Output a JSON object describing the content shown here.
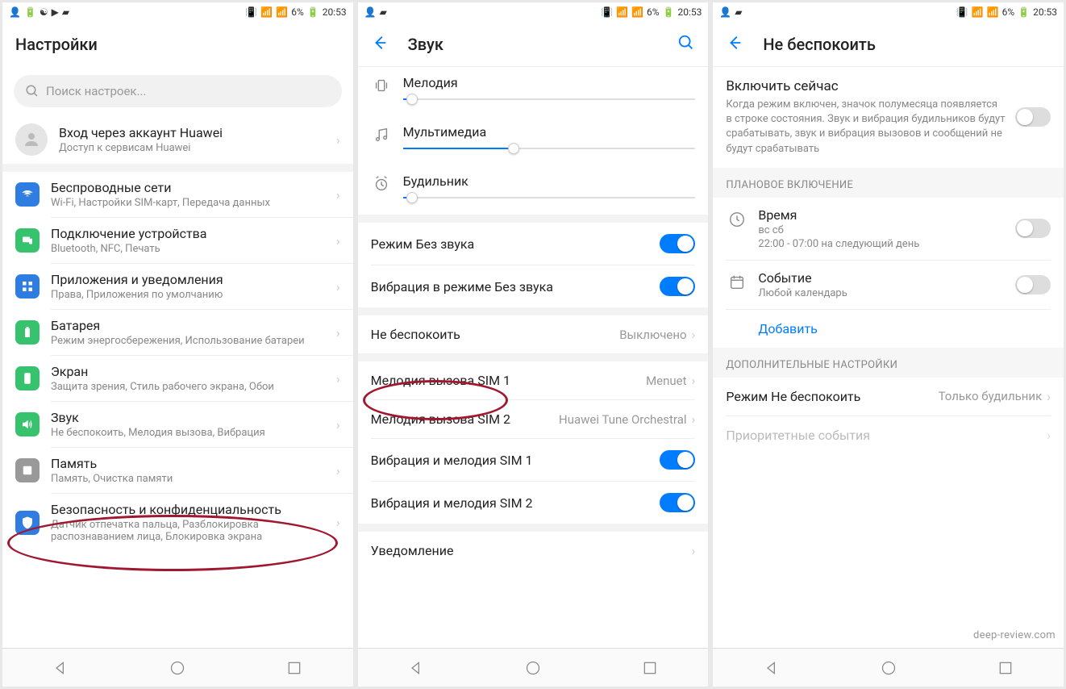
{
  "status": {
    "battery": "6%",
    "time": "20:53"
  },
  "screen1": {
    "title": "Настройки",
    "search_placeholder": "Поиск настроек...",
    "account": {
      "title": "Вход через аккаунт Huawei",
      "subtitle": "Доступ к сервисам Huawei"
    },
    "items": [
      {
        "title": "Беспроводные сети",
        "subtitle": "Wi-Fi, Настройки SIM-карт, Передача данных",
        "color": "#2f7de1"
      },
      {
        "title": "Подключение устройства",
        "subtitle": "Bluetooth, NFC, Печать",
        "color": "#37c26d"
      },
      {
        "title": "Приложения и уведомления",
        "subtitle": "Права, Приложения по умолчанию",
        "color": "#2f7de1"
      },
      {
        "title": "Батарея",
        "subtitle": "Режим энергосбережения, Использование батареи",
        "color": "#37c26d"
      },
      {
        "title": "Экран",
        "subtitle": "Защита зрения, Стиль рабочего экрана, Обои",
        "color": "#37c26d"
      },
      {
        "title": "Звук",
        "subtitle": "Не беспокоить, Мелодия вызова, Вибрация",
        "color": "#37c26d"
      },
      {
        "title": "Память",
        "subtitle": "Память, Очистка памяти",
        "color": "#999"
      },
      {
        "title": "Безопасность и конфиденциальность",
        "subtitle": "Датчик отпечатка пальца, Разблокировка распознаванием лица, Блокировка экрана",
        "color": "#2f7de1"
      }
    ]
  },
  "screen2": {
    "title": "Звук",
    "sliders": [
      {
        "label": "Мелодия",
        "value": 3
      },
      {
        "label": "Мультимедиа",
        "value": 38
      },
      {
        "label": "Будильник",
        "value": 3
      }
    ],
    "toggles": [
      {
        "label": "Режим Без звука",
        "on": true
      },
      {
        "label": "Вибрация в режиме Без звука",
        "on": true
      }
    ],
    "dnd": {
      "label": "Не беспокоить",
      "value": "Выключено"
    },
    "sim": [
      {
        "label": "Мелодия вызова SIM 1",
        "value": "Menuet"
      },
      {
        "label": "Мелодия вызова SIM 2",
        "value": "Huawei Tune Orchestral"
      }
    ],
    "vib": [
      {
        "label": "Вибрация и мелодия SIM 1",
        "on": true
      },
      {
        "label": "Вибрация и мелодия SIM 2",
        "on": true
      }
    ],
    "notif_label": "Уведомление"
  },
  "screen3": {
    "title": "Не беспокоить",
    "enable_now": {
      "title": "Включить сейчас",
      "desc": "Когда режим включен, значок полумесяца появляется в строке состояния. Звук и вибрация будильников будут срабатывать, звук и вибрация вызовов и сообщений не будут срабатывать"
    },
    "section_schedule": "ПЛАНОВОЕ ВКЛЮЧЕНИЕ",
    "time": {
      "title": "Время",
      "days": "вс сб",
      "range": "22:00 - 07:00 на следующий день"
    },
    "event": {
      "title": "Событие",
      "subtitle": "Любой календарь"
    },
    "add": "Добавить",
    "section_extra": "ДОПОЛНИТЕЛЬНЫЕ НАСТРОЙКИ",
    "mode": {
      "label": "Режим Не беспокоить",
      "value": "Только будильник"
    },
    "priority": "Приоритетные события"
  },
  "watermark": "deep-review.com"
}
